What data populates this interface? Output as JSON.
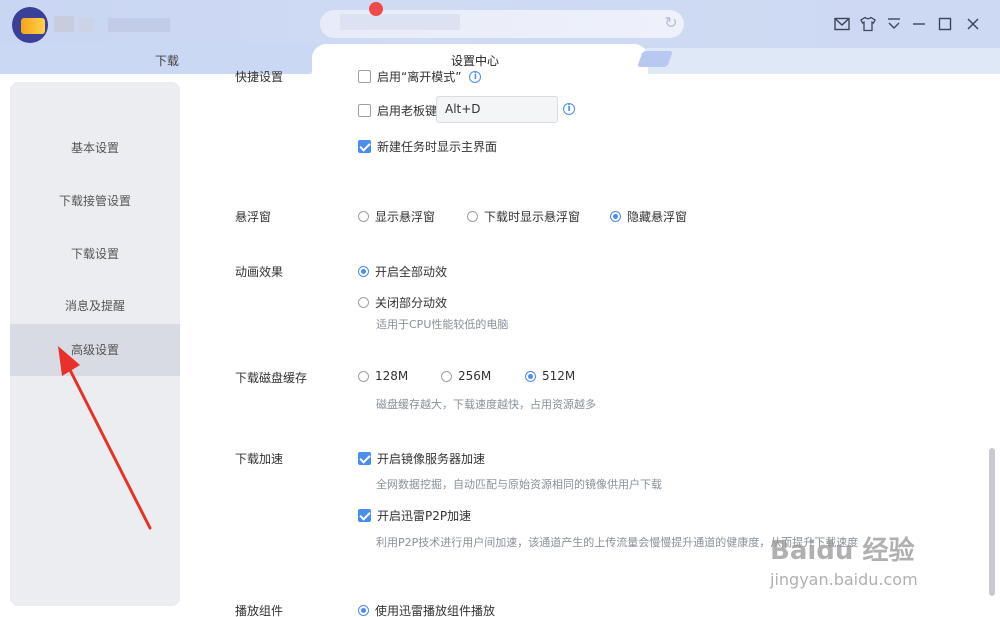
{
  "tabs": {
    "download": "下载",
    "settings": "设置中心"
  },
  "sidebar": {
    "items": [
      {
        "label": "基本设置"
      },
      {
        "label": "下载接管设置"
      },
      {
        "label": "下载设置"
      },
      {
        "label": "消息及提醒"
      },
      {
        "label": "高级设置"
      }
    ],
    "active": "高级设置"
  },
  "settings": {
    "shortcuts": {
      "label": "快捷设置",
      "leave_mode": "启用“离开模式”",
      "boss_key": "启用老板键",
      "boss_key_value": "Alt+D",
      "boss_key_checked": false,
      "show_main": "新建任务时显示主界面",
      "show_main_checked": true
    },
    "float_window": {
      "label": "悬浮窗",
      "options": [
        "显示悬浮窗",
        "下载时显示悬浮窗",
        "隐藏悬浮窗"
      ],
      "selected": "隐藏悬浮窗"
    },
    "animation": {
      "label": "动画效果",
      "options": [
        "开启全部动效",
        "关闭部分动效"
      ],
      "selected": "开启全部动效",
      "hint": "适用于CPU性能较低的电脑"
    },
    "disk_cache": {
      "label": "下载磁盘缓存",
      "options": [
        "128M",
        "256M",
        "512M"
      ],
      "selected": "512M",
      "hint": "磁盘缓存越大，下载速度越快，占用资源越多"
    },
    "acceleration": {
      "label": "下载加速",
      "mirror": "开启镜像服务器加速",
      "mirror_checked": true,
      "mirror_hint": "全网数据挖掘，自动匹配与原始资源相同的镜像供用户下载",
      "p2p": "开启迅雷P2P加速",
      "p2p_checked": true,
      "p2p_hint": "利用P2P技术进行用户间加速，该通道产生的上传流量会慢慢提升通道的健康度，从而提升下载速度"
    },
    "player": {
      "label": "播放组件",
      "option": "使用迅雷播放组件播放"
    }
  },
  "watermark": {
    "line1": "Baidu 经验",
    "line2": "jingyan.baidu.com"
  },
  "colors": {
    "accent": "#4a8cf0",
    "annotation_arrow": "#e8312a"
  }
}
